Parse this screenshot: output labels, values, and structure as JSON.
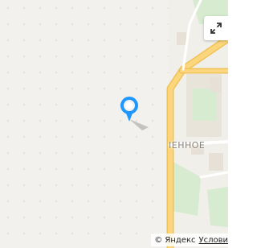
{
  "map": {
    "district_label": "IEHHOE",
    "copyright": {
      "text": "© Яндекс",
      "terms_link": "Услови"
    },
    "controls": {
      "expand_icon": "expand-diagonal-icon"
    },
    "marker": {
      "icon": "location-pin-icon",
      "color": "#1e98ff"
    },
    "colors": {
      "road": "#fbd67c",
      "road_edge": "#f0c35a",
      "greenery": "#d6ebcf",
      "building": "#e6e0d6",
      "background": "#f3f1ed"
    }
  }
}
